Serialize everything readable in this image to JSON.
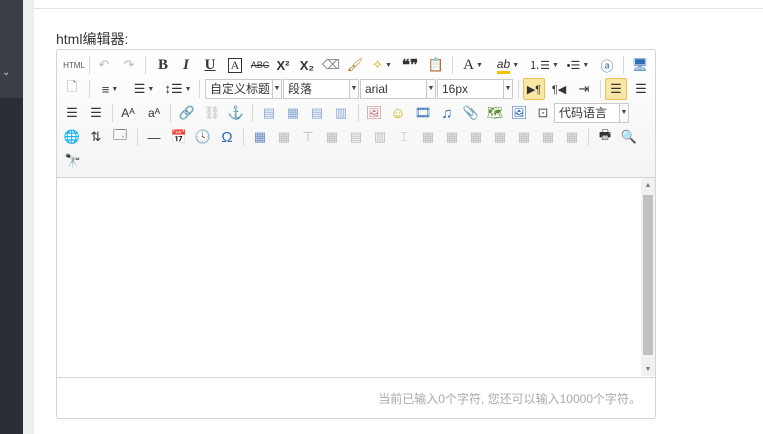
{
  "field": {
    "label": "html编辑器:"
  },
  "sidebar": {
    "collapse_glyph": "⌄"
  },
  "toolbar": {
    "html_label": "HTML",
    "undo_glyph": "↶",
    "redo_glyph": "↷",
    "bold": "B",
    "italic": "I",
    "underline": "U",
    "fontborder": "A",
    "strike": "ABC",
    "superscript": "X²",
    "subscript": "X₂",
    "eraser": "⌫",
    "brush": "🖌",
    "magic": "✧",
    "quote": "❝❞",
    "paste": "📋",
    "forecolor": "A",
    "backcolor": "ab",
    "ol_glyph": "⒈☰",
    "ul_glyph": "•☰",
    "cleardoc": "ⓐ",
    "preview_glyph": "🖥",
    "select_all_glyph": "🗋",
    "rowspacing": "≡",
    "rowspacing2": "☰",
    "lineheight": "↕☰",
    "customstyle": "自定义标题",
    "paragraph": "段落",
    "fontfamily": "arial",
    "fontsize": "16px",
    "ltr_glyph": "▶¶",
    "rtl_glyph": "¶◀",
    "indent_glyph": "⇥",
    "justifyleft": "☰",
    "justifycenter": "☰",
    "justifyright": "☰",
    "justifyjustify": "☰",
    "toupper": "Aᴬ",
    "tolower": "aᴬ",
    "link_glyph": "🔗",
    "unlink_glyph": "⛓",
    "anchor_glyph": "⚓",
    "img_left": "▤",
    "img_none": "▦",
    "img_right": "▤",
    "img_center": "▥",
    "image_glyph": "🖼",
    "emotion_glyph": "☺",
    "video_glyph": "🎞",
    "music_glyph": "♫",
    "attach_glyph": "📎",
    "map_glyph": "🗺",
    "gmap_glyph": "🖼",
    "frame_glyph": "⊡",
    "insertcode": "代码语言",
    "web_glyph": "🌐",
    "pagebreak_glyph": "⇅",
    "template_glyph": "🗔",
    "hr_glyph": "—",
    "date_glyph": "📅",
    "time_glyph": "🕓",
    "omega": "Ω",
    "table_glyph": "▦",
    "t2": "▦",
    "t3": "⊤",
    "t4": "▦",
    "t5": "▤",
    "t6": "▥",
    "t7": "⌶",
    "t8": "▦",
    "t9": "▦",
    "t10": "▦",
    "t11": "▦",
    "t12": "▦",
    "t13": "▦",
    "t14": "▦",
    "print_glyph": "🖶",
    "search_glyph": "🔍",
    "replace_glyph": "🔭"
  },
  "status": {
    "wordcount": "当前已输入0个字符, 您还可以输入10000个字符。"
  },
  "colors": {
    "sidebar_dark": "#2a2f37",
    "active_bg": "#fbe7a5"
  }
}
